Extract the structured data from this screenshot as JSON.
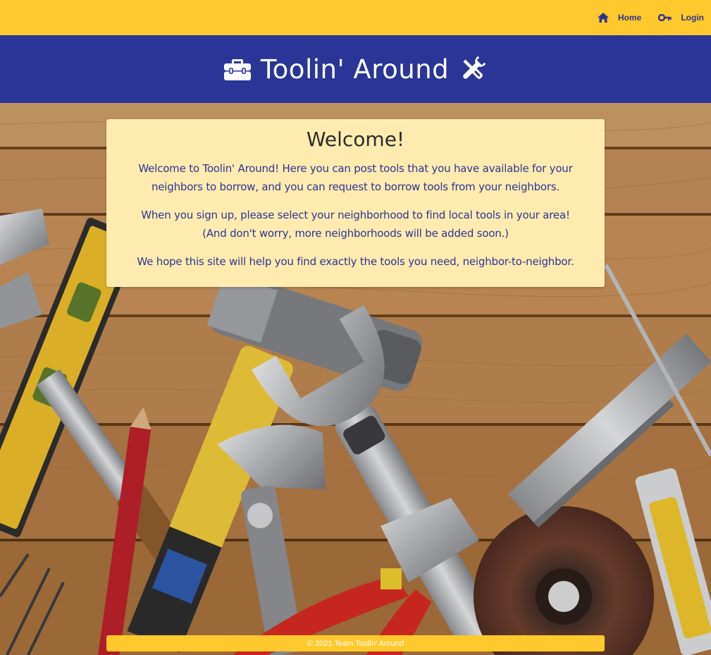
{
  "nav": {
    "home_label": "Home",
    "login_label": "Login"
  },
  "banner": {
    "title": "Toolin' Around"
  },
  "welcome": {
    "heading": "Welcome!",
    "paragraph_1": "Welcome to Toolin' Around! Here you can post tools that you have available for your neighbors to borrow, and you can request to borrow tools from your neighbors.",
    "paragraph_2_line_1": "When you sign up, please select your neighborhood to find local tools in your area!",
    "paragraph_2_line_2": "(And don't worry, more neighborhoods will be added soon.)",
    "paragraph_3": "We hope this site will help you find exactly the tools you need, neighbor-to-neighbor."
  },
  "footer": {
    "text": "© 2021 Team Toolin' Around"
  },
  "colors": {
    "nav_bg": "#ffc82c",
    "banner_bg": "#2a3597",
    "card_bg": "#ffebb0",
    "text_blue": "#2a3590"
  },
  "icons": {
    "home": "home-icon",
    "login": "key-icon",
    "toolbox": "toolbox-icon",
    "tools": "wrench-screwdriver-icon"
  }
}
